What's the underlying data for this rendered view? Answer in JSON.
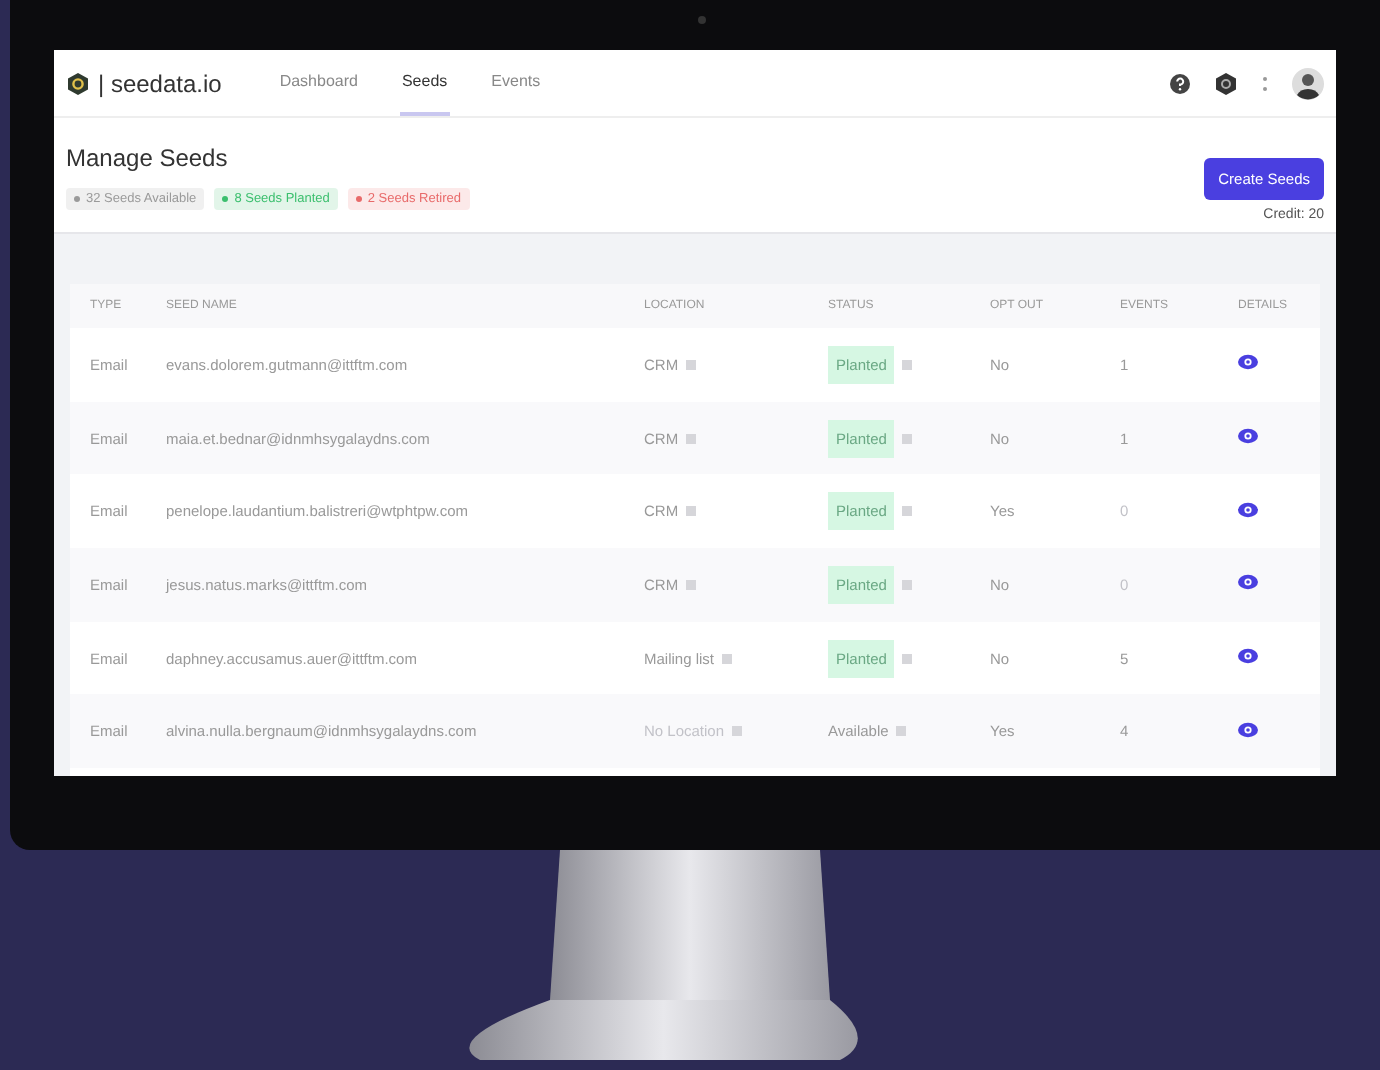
{
  "nav": {
    "brand": "| seedata.io",
    "tabs": [
      {
        "label": "Dashboard",
        "selected": false
      },
      {
        "label": "Seeds",
        "selected": true
      },
      {
        "label": "Events",
        "selected": false
      }
    ]
  },
  "header": {
    "title": "Manage Seeds",
    "badges": [
      {
        "text": "32 Seeds Available",
        "color": "#9a9a9a"
      },
      {
        "text": "8 Seeds Planted",
        "color": "#3bbf6e"
      },
      {
        "text": "2 Seeds Retired",
        "color": "#e86a6a"
      }
    ],
    "button": "Create Seeds",
    "credit": "Credit: 20"
  },
  "table": {
    "columns": [
      "TYPE",
      "SEED NAME",
      "LOCATION",
      "STATUS",
      "OPT OUT",
      "EVENTS",
      "DETAILS"
    ],
    "rows": [
      {
        "type": "Email",
        "name": "evans.dolorem.gutmann@ittftm.com",
        "location": "CRM",
        "location_missing": false,
        "status": "Planted",
        "status_highlighted": true,
        "opt_out": "No",
        "events": "1",
        "events_zero": false
      },
      {
        "type": "Email",
        "name": "maia.et.bednar@idnmhsygalaydns.com",
        "location": "CRM",
        "location_missing": false,
        "status": "Planted",
        "status_highlighted": true,
        "opt_out": "No",
        "events": "1",
        "events_zero": false
      },
      {
        "type": "Email",
        "name": "penelope.laudantium.balistreri@wtphtpw.com",
        "location": "CRM",
        "location_missing": false,
        "status": "Planted",
        "status_highlighted": true,
        "opt_out": "Yes",
        "events": "0",
        "events_zero": true
      },
      {
        "type": "Email",
        "name": "jesus.natus.marks@ittftm.com",
        "location": "CRM",
        "location_missing": false,
        "status": "Planted",
        "status_highlighted": true,
        "opt_out": "No",
        "events": "0",
        "events_zero": true
      },
      {
        "type": "Email",
        "name": "daphney.accusamus.auer@ittftm.com",
        "location": "Mailing list",
        "location_missing": false,
        "status": "Planted",
        "status_highlighted": true,
        "opt_out": "No",
        "events": "5",
        "events_zero": false
      },
      {
        "type": "Email",
        "name": "alvina.nulla.bergnaum@idnmhsygalaydns.com",
        "location": "No Location",
        "location_missing": true,
        "status": "Available",
        "status_highlighted": false,
        "opt_out": "Yes",
        "events": "4",
        "events_zero": false
      }
    ]
  }
}
